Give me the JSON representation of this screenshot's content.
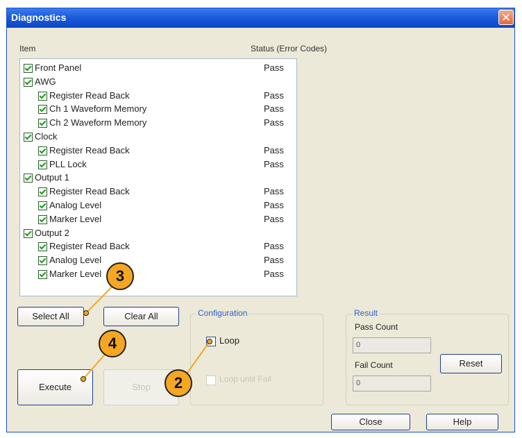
{
  "window": {
    "title": "Diagnostics",
    "close_symbol": "✕"
  },
  "columns": {
    "item": "Item",
    "status": "Status (Error Codes)"
  },
  "tree": [
    {
      "label": "Front Panel",
      "level": 0,
      "status": "Pass"
    },
    {
      "label": "AWG",
      "level": 0,
      "status": ""
    },
    {
      "label": "Register Read Back",
      "level": 1,
      "status": "Pass"
    },
    {
      "label": "Ch 1 Waveform Memory",
      "level": 1,
      "status": "Pass"
    },
    {
      "label": "Ch 2 Waveform Memory",
      "level": 1,
      "status": "Pass"
    },
    {
      "label": "Clock",
      "level": 0,
      "status": ""
    },
    {
      "label": "Register Read Back",
      "level": 1,
      "status": "Pass"
    },
    {
      "label": "PLL Lock",
      "level": 1,
      "status": "Pass"
    },
    {
      "label": "Output 1",
      "level": 0,
      "status": ""
    },
    {
      "label": "Register Read Back",
      "level": 1,
      "status": "Pass"
    },
    {
      "label": "Analog Level",
      "level": 1,
      "status": "Pass"
    },
    {
      "label": "Marker Level",
      "level": 1,
      "status": "Pass"
    },
    {
      "label": "Output 2",
      "level": 0,
      "status": ""
    },
    {
      "label": "Register Read Back",
      "level": 1,
      "status": "Pass"
    },
    {
      "label": "Analog Level",
      "level": 1,
      "status": "Pass"
    },
    {
      "label": "Marker Level",
      "level": 1,
      "status": "Pass"
    }
  ],
  "buttons": {
    "select_all": "Select All",
    "clear_all": "Clear All",
    "execute": "Execute",
    "stop": "Stop",
    "reset": "Reset",
    "close": "Close",
    "help": "Help"
  },
  "configuration": {
    "title": "Configuration",
    "loop": "Loop",
    "loop_until_fail": "Loop until Fail"
  },
  "result": {
    "title": "Result",
    "pass_count_label": "Pass Count",
    "pass_count": "0",
    "fail_count_label": "Fail Count",
    "fail_count": "0"
  },
  "callouts": {
    "three": "3",
    "four": "4",
    "two": "2"
  }
}
